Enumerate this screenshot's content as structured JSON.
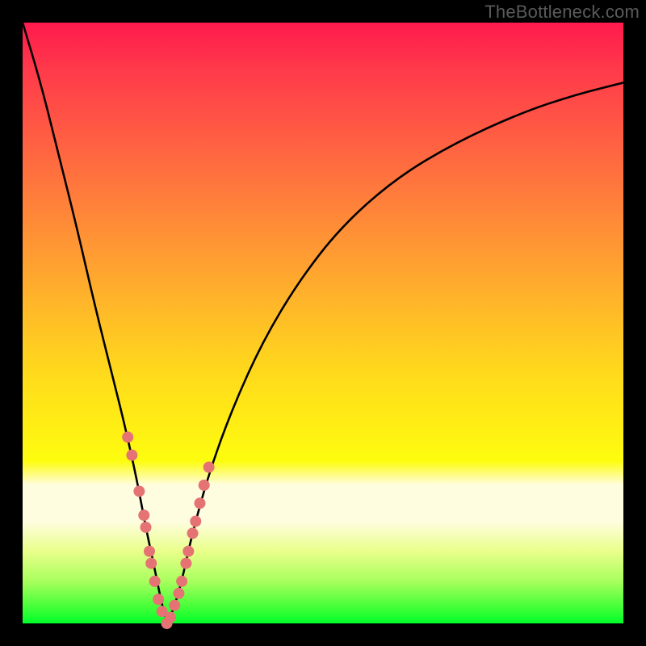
{
  "watermark": "TheBottleneck.com",
  "colors": {
    "curve": "#000000",
    "marker_fill": "#e57373",
    "marker_stroke": "#b04848",
    "gradient_top": "#ff1a4d",
    "gradient_bottom": "#00ff2a"
  },
  "chart_data": {
    "type": "line",
    "title": "",
    "xlabel": "",
    "ylabel": "",
    "xlim": [
      0,
      100
    ],
    "ylim": [
      0,
      100
    ],
    "x_min_at": 24,
    "curve": {
      "x": [
        0,
        3,
        6,
        9,
        12,
        15,
        17,
        19,
        20.5,
        22,
        23,
        24,
        25,
        26.5,
        28,
        31,
        35,
        40,
        46,
        53,
        62,
        72,
        83,
        92,
        100
      ],
      "y": [
        100,
        90,
        78,
        66,
        53,
        41,
        33,
        24,
        16,
        9,
        4,
        0,
        2,
        7,
        14,
        25,
        36,
        47,
        57,
        66,
        74,
        80,
        85,
        88,
        90
      ]
    },
    "markers": {
      "x": [
        17.5,
        18.2,
        19.4,
        20.2,
        20.5,
        21.1,
        21.4,
        22.0,
        22.6,
        23.2,
        24.0,
        24.6,
        25.3,
        26.0,
        26.5,
        27.2,
        27.6,
        28.3,
        28.8,
        29.5,
        30.2,
        31.0
      ],
      "y": [
        31,
        28,
        22,
        18,
        16,
        12,
        10,
        7,
        4,
        2,
        0,
        1,
        3,
        5,
        7,
        10,
        12,
        15,
        17,
        20,
        23,
        26
      ]
    },
    "legend": [],
    "grid": false
  }
}
